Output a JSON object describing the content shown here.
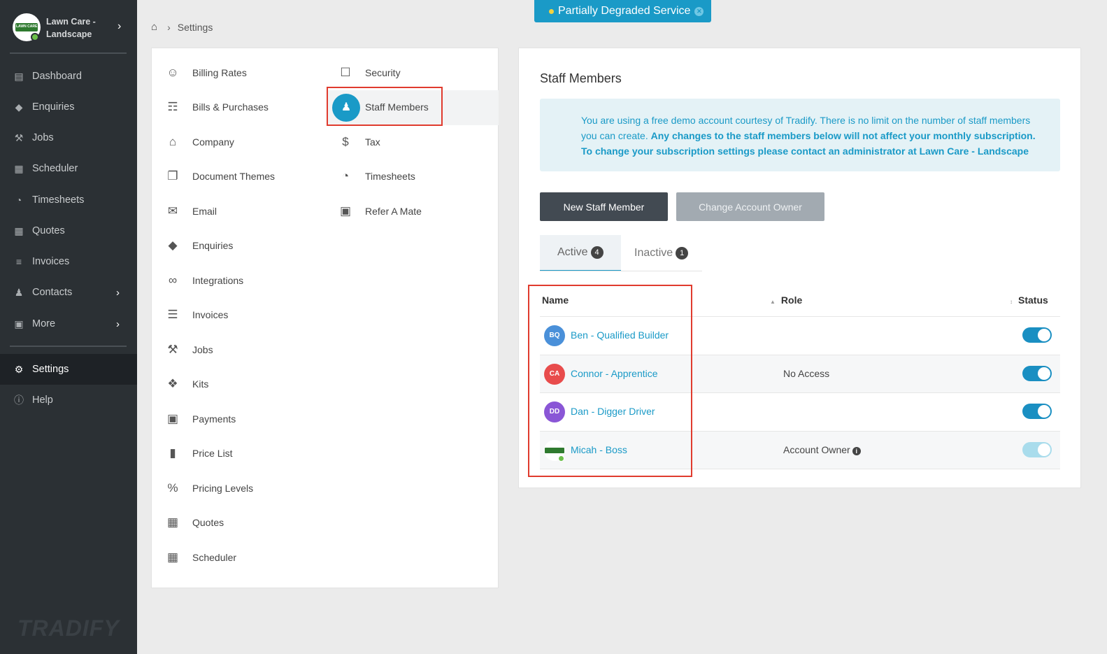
{
  "sidebar": {
    "org_name": "Lawn Care - Landscape",
    "items": [
      {
        "label": "Dashboard",
        "icon": "dashboard-icon"
      },
      {
        "label": "Enquiries",
        "icon": "tags-icon"
      },
      {
        "label": "Jobs",
        "icon": "hammer-icon"
      },
      {
        "label": "Scheduler",
        "icon": "calendar-icon"
      },
      {
        "label": "Timesheets",
        "icon": "clock-icon"
      },
      {
        "label": "Quotes",
        "icon": "calculator-icon"
      },
      {
        "label": "Invoices",
        "icon": "invoice-icon"
      },
      {
        "label": "Contacts",
        "icon": "users-icon"
      },
      {
        "label": "More",
        "icon": "grid-icon"
      },
      {
        "label": "Settings",
        "icon": "gear-icon"
      },
      {
        "label": "Help",
        "icon": "help-icon"
      }
    ],
    "brand": "TRADIFY"
  },
  "banner": {
    "text": "Partially Degraded Service"
  },
  "breadcrumb": {
    "current": "Settings"
  },
  "settings_menu": {
    "left": [
      {
        "label": "Billing Rates",
        "icon": "person-icon"
      },
      {
        "label": "Bills & Purchases",
        "icon": "cart-icon"
      },
      {
        "label": "Company",
        "icon": "home-icon"
      },
      {
        "label": "Document Themes",
        "icon": "copy-icon"
      },
      {
        "label": "Email",
        "icon": "envelope-icon"
      },
      {
        "label": "Enquiries",
        "icon": "tags-icon"
      },
      {
        "label": "Integrations",
        "icon": "link-icon"
      },
      {
        "label": "Invoices",
        "icon": "file-icon"
      },
      {
        "label": "Jobs",
        "icon": "hammer-icon"
      },
      {
        "label": "Kits",
        "icon": "cubes-icon"
      },
      {
        "label": "Payments",
        "icon": "money-icon"
      },
      {
        "label": "Price List",
        "icon": "book-icon"
      },
      {
        "label": "Pricing Levels",
        "icon": "percent-icon"
      },
      {
        "label": "Quotes",
        "icon": "calculator-icon"
      },
      {
        "label": "Scheduler",
        "icon": "calendar-icon"
      }
    ],
    "right": [
      {
        "label": "Security",
        "icon": "unlock-icon"
      },
      {
        "label": "Staff Members",
        "icon": "users-icon"
      },
      {
        "label": "Tax",
        "icon": "dollar-icon"
      },
      {
        "label": "Timesheets",
        "icon": "clock-icon"
      },
      {
        "label": "Refer A Mate",
        "icon": "gift-icon"
      }
    ]
  },
  "staff": {
    "title": "Staff Members",
    "info_normal": "You are using a free demo account courtesy of Tradify. There is no limit on the number of staff members you can create. ",
    "info_bold": "Any changes to the staff members below will not affect your monthly subscription. To change your subscription settings please contact an administrator at Lawn Care - Landscape",
    "btn_new": "New Staff Member",
    "btn_owner": "Change Account Owner",
    "tabs": [
      {
        "label": "Active",
        "count": "4"
      },
      {
        "label": "Inactive",
        "count": "1"
      }
    ],
    "columns": {
      "name": "Name",
      "role": "Role",
      "status": "Status"
    },
    "rows": [
      {
        "initials": "BQ",
        "name": "Ben - Qualified Builder",
        "role": "",
        "color": "#4a90d9"
      },
      {
        "initials": "CA",
        "name": "Connor - Apprentice",
        "role": "No Access",
        "color": "#e84c4c"
      },
      {
        "initials": "DD",
        "name": "Dan - Digger Driver",
        "role": "",
        "color": "#8a56d6"
      },
      {
        "initials": "",
        "name": "Micah - Boss",
        "role": "Account Owner",
        "color": "#ffffff"
      }
    ]
  }
}
